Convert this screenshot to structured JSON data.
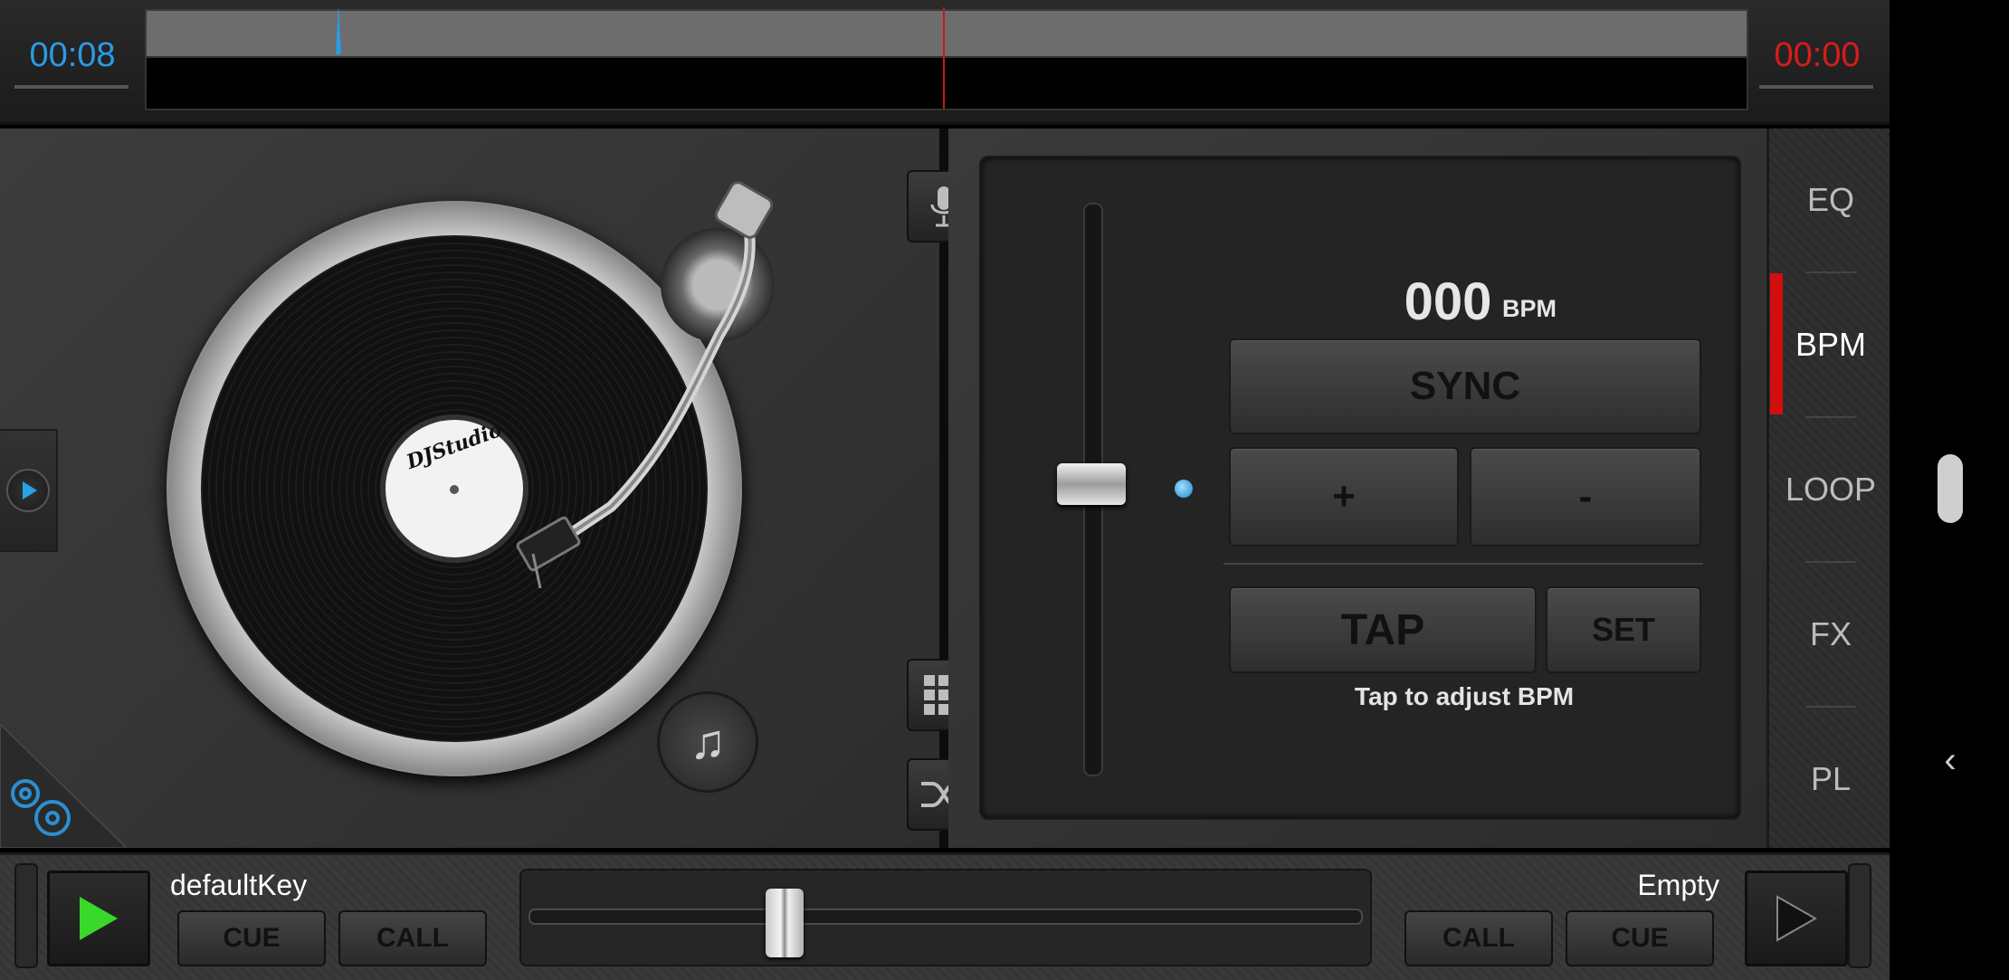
{
  "top_bar": {
    "time_left": "00:08",
    "time_right": "00:00"
  },
  "left_deck": {
    "record_label": "DJStudio",
    "icons": [
      "play-icon",
      "music-add-icon",
      "settings-gears-icon"
    ]
  },
  "center_tools": {
    "icons": [
      "microphone-icon",
      "grid-icon",
      "shuffle-icon",
      "play-icon"
    ]
  },
  "bpm_panel": {
    "bpm_value": "000",
    "bpm_unit": "BPM",
    "sync_label": "SYNC",
    "plus_label": "+",
    "minus_label": "-",
    "tap_label": "TAP",
    "set_label": "SET",
    "hint": "Tap to adjust BPM"
  },
  "side_tabs": [
    {
      "label": "EQ"
    },
    {
      "label": "BPM"
    },
    {
      "label": "LOOP"
    },
    {
      "label": "FX"
    },
    {
      "label": "PL"
    }
  ],
  "active_tab": "BPM",
  "bottom": {
    "left_track": "defaultKey",
    "right_track": "Empty",
    "left_cue": "CUE",
    "left_call": "CALL",
    "right_call": "CALL",
    "right_cue": "CUE"
  },
  "colors": {
    "time_left": "#2b9be3",
    "time_right": "#d81c1c",
    "active_tab_indicator": "#d20e0e",
    "play_green": "#39d82a"
  },
  "nav": {
    "back_glyph": "‹"
  }
}
